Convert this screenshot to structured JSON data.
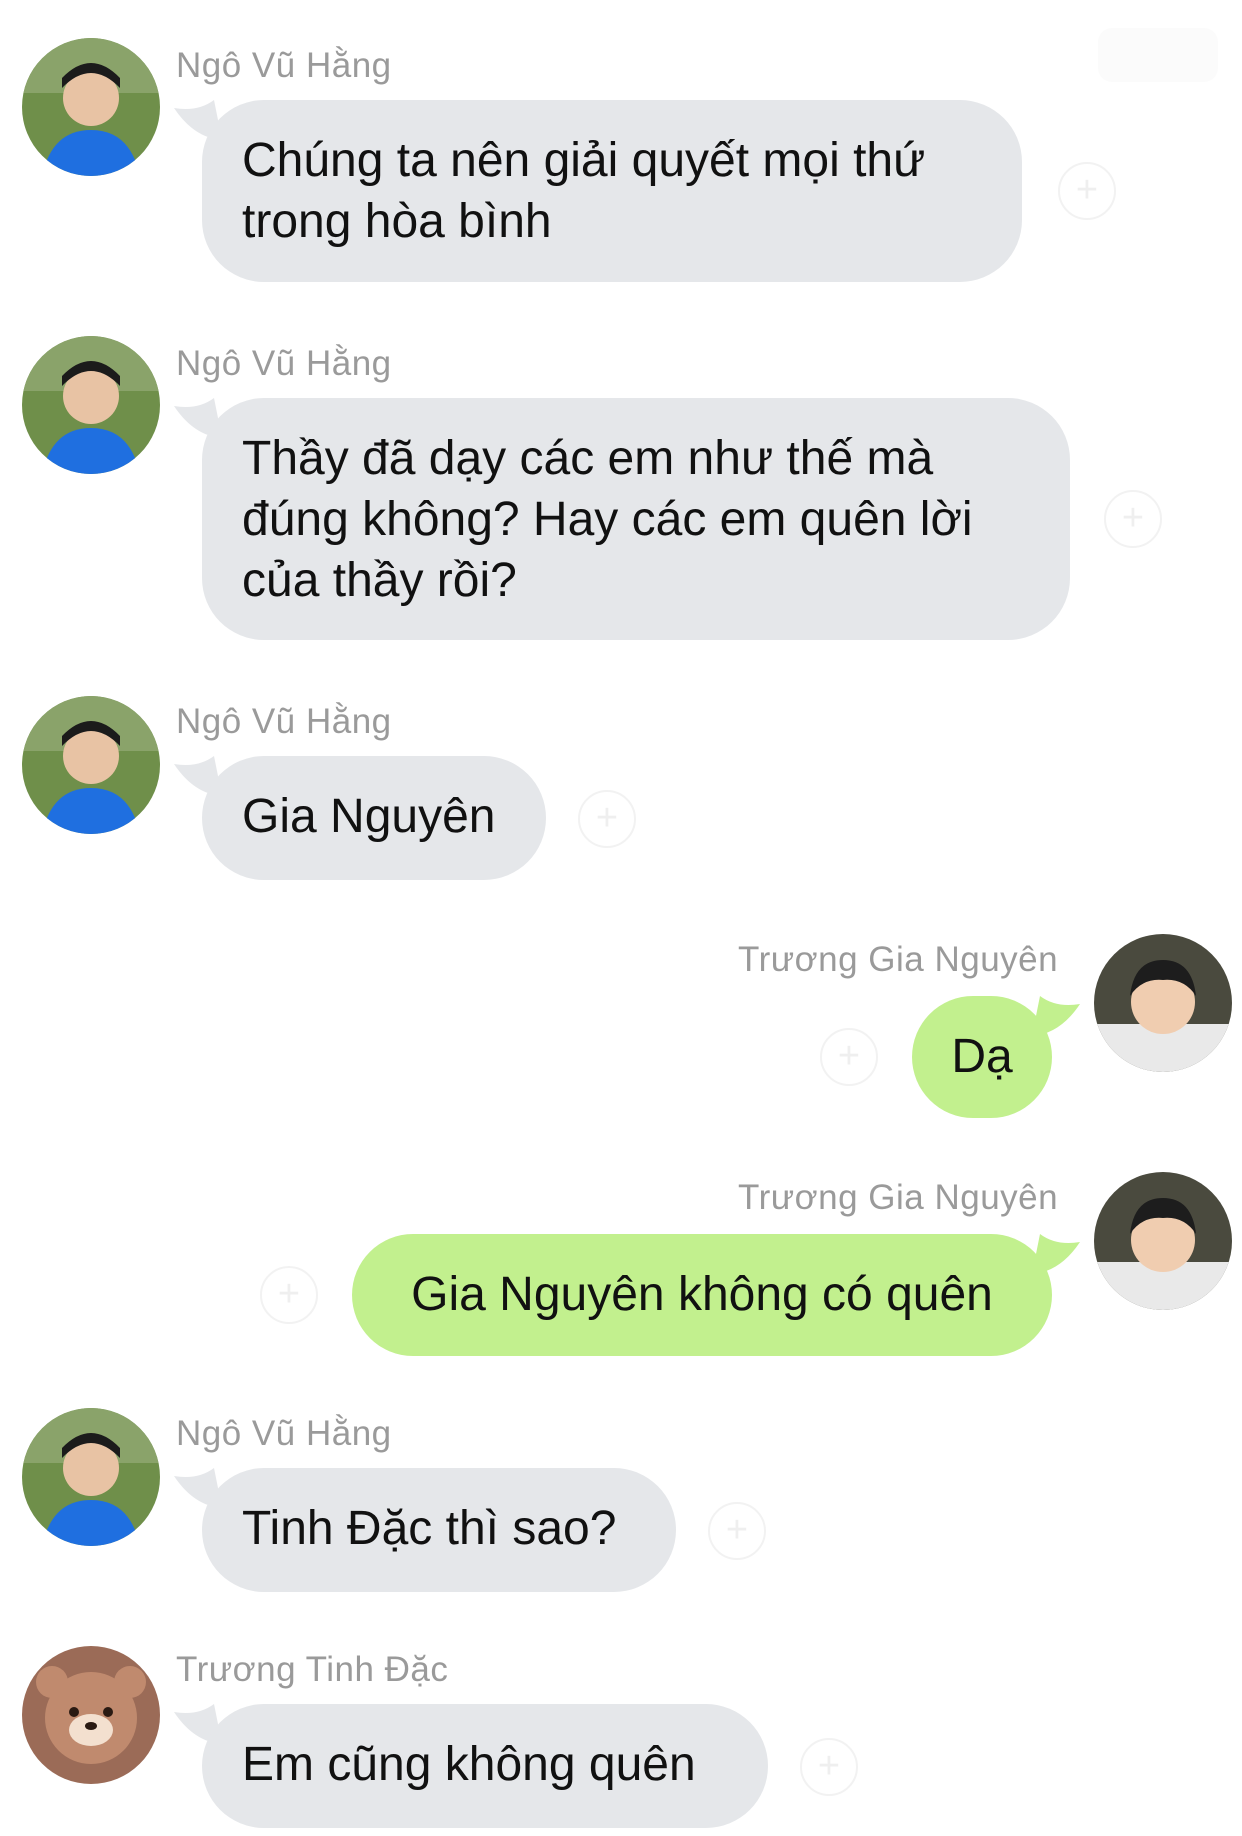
{
  "colors": {
    "incoming_bubble": "#e5e7ea",
    "outgoing_bubble": "#c2f08e",
    "sender_name": "#9a9a9a",
    "text": "#111111"
  },
  "icons": {
    "reaction": "add-reaction-icon",
    "reaction_glyph": "+"
  },
  "messages": [
    {
      "sender": "Ngô Vũ Hằng",
      "text_lines": [
        "Chúng ta nên giải quyết mọi thứ",
        "trong hòa bình"
      ],
      "direction": "incoming",
      "avatar": "teacher-avatar"
    },
    {
      "sender": "Ngô Vũ Hằng",
      "text_lines": [
        "Thầy đã dạy các em như thế mà",
        "đúng không? Hay các em quên lời",
        "của thầy rồi?"
      ],
      "direction": "incoming",
      "avatar": "teacher-avatar"
    },
    {
      "sender": "Ngô Vũ Hằng",
      "text_lines": [
        "Gia Nguyên"
      ],
      "direction": "incoming",
      "avatar": "teacher-avatar"
    },
    {
      "sender": "Trương Gia Nguyên",
      "text_lines": [
        "Dạ"
      ],
      "direction": "outgoing",
      "avatar": "child-avatar"
    },
    {
      "sender": "Trương Gia Nguyên",
      "text_lines": [
        "Gia Nguyên không có quên"
      ],
      "direction": "outgoing",
      "avatar": "child-avatar"
    },
    {
      "sender": "Ngô Vũ Hằng",
      "text_lines": [
        "Tinh Đặc thì sao?"
      ],
      "direction": "incoming",
      "avatar": "teacher-avatar"
    },
    {
      "sender": "Trương Tinh Đặc",
      "text_lines": [
        "Em cũng không quên"
      ],
      "direction": "incoming",
      "avatar": "bear-avatar"
    }
  ]
}
